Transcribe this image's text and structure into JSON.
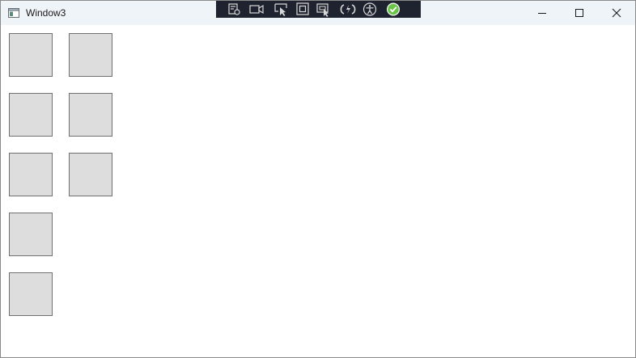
{
  "window": {
    "title": "Window3"
  },
  "icons": {
    "app": "window-app-icon",
    "minimize": "minimize-icon",
    "maximize": "maximize-icon",
    "close": "close-icon"
  },
  "debug_toolbar": {
    "buttons": [
      "live-visual-tree-icon",
      "record-icon",
      "select-element-icon",
      "display-adorners-icon",
      "track-focus-icon",
      "hot-reload-icon",
      "accessibility-icon",
      "check-icon"
    ]
  },
  "colors": {
    "titlebar": "#eff4f9",
    "toolbar": "#1f2330",
    "tile_fill": "#dddddd",
    "tile_border": "#707070",
    "check_green": "#6cc24a"
  },
  "content": {
    "tile_count": 8
  }
}
